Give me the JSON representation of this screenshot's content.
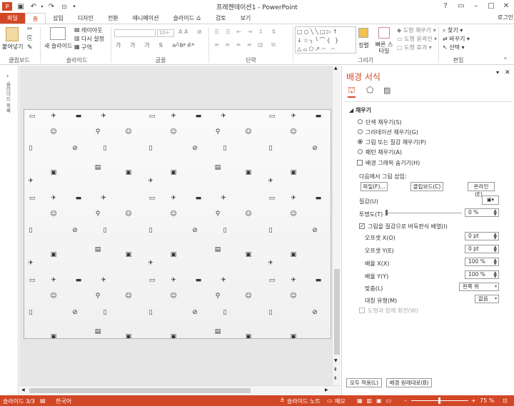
{
  "window": {
    "title": "프레젠테이션1 - PowerPoint",
    "account": "로그인"
  },
  "tabs": [
    "파일",
    "홈",
    "삽입",
    "디자인",
    "전환",
    "애니메이션",
    "슬라이드 쇼",
    "검토",
    "보기"
  ],
  "ribbon": {
    "groups": [
      "클립보드",
      "슬라이드",
      "글꼴",
      "단락",
      "그리기",
      "편집"
    ],
    "paste": "붙여넣기",
    "new_slide": "새 슬라이드",
    "layout": "레이아웃",
    "reset": "다시 설정",
    "section": "구역",
    "arrange": "정렬",
    "quick_styles": "빠른 스타일",
    "shape_fill": "도형 채우기",
    "shape_outline": "도형 윤곽선",
    "shape_effects": "도형 효과",
    "find": "찾기",
    "replace": "바꾸기",
    "select": "선택",
    "font_size": "10+"
  },
  "thumbnail_label": "슬라이드 목록",
  "pane": {
    "title": "배경 서식",
    "section": "채우기",
    "fill_options": [
      "단색 채우기(S)",
      "그라데이션 채우기(G)",
      "그림 또는 질감 채우기(P)",
      "패턴 채우기(A)"
    ],
    "hide_bg": "배경 그래픽 숨기기(H)",
    "insert_from": "다음에서 그림 삽입:",
    "btn_file": "파일(F)...",
    "btn_clipboard": "클립보드(C)",
    "btn_online": "온라인(E)...",
    "texture": "질감(U)",
    "transparency": "투명도(T)",
    "transparency_val": "0 %",
    "tile_as_texture": "그림을 질감으로 바둑판식 배열(I)",
    "offset_x": "오프셋 X(O)",
    "offset_x_val": "0 pt",
    "offset_y": "오프셋 Y(E)",
    "offset_y_val": "0 pt",
    "scale_x": "배율 X(X)",
    "scale_x_val": "100 %",
    "scale_y": "배율 Y(Y)",
    "scale_y_val": "100 %",
    "alignment": "맞춤(L)",
    "alignment_val": "왼쪽 위",
    "mirror": "대칭 유형(M)",
    "mirror_val": "없음",
    "rotate_with_shape": "도형과 함께 회전(W)",
    "apply_all": "모두 적용(L)",
    "reset_bg": "배경 원래대로(B)"
  },
  "status": {
    "slide": "슬라이드 3/3",
    "lang": "한국어",
    "notes": "슬라이드 노트",
    "comments": "메모",
    "zoom": "75 %"
  },
  "colors": {
    "accent": "#d24726"
  }
}
